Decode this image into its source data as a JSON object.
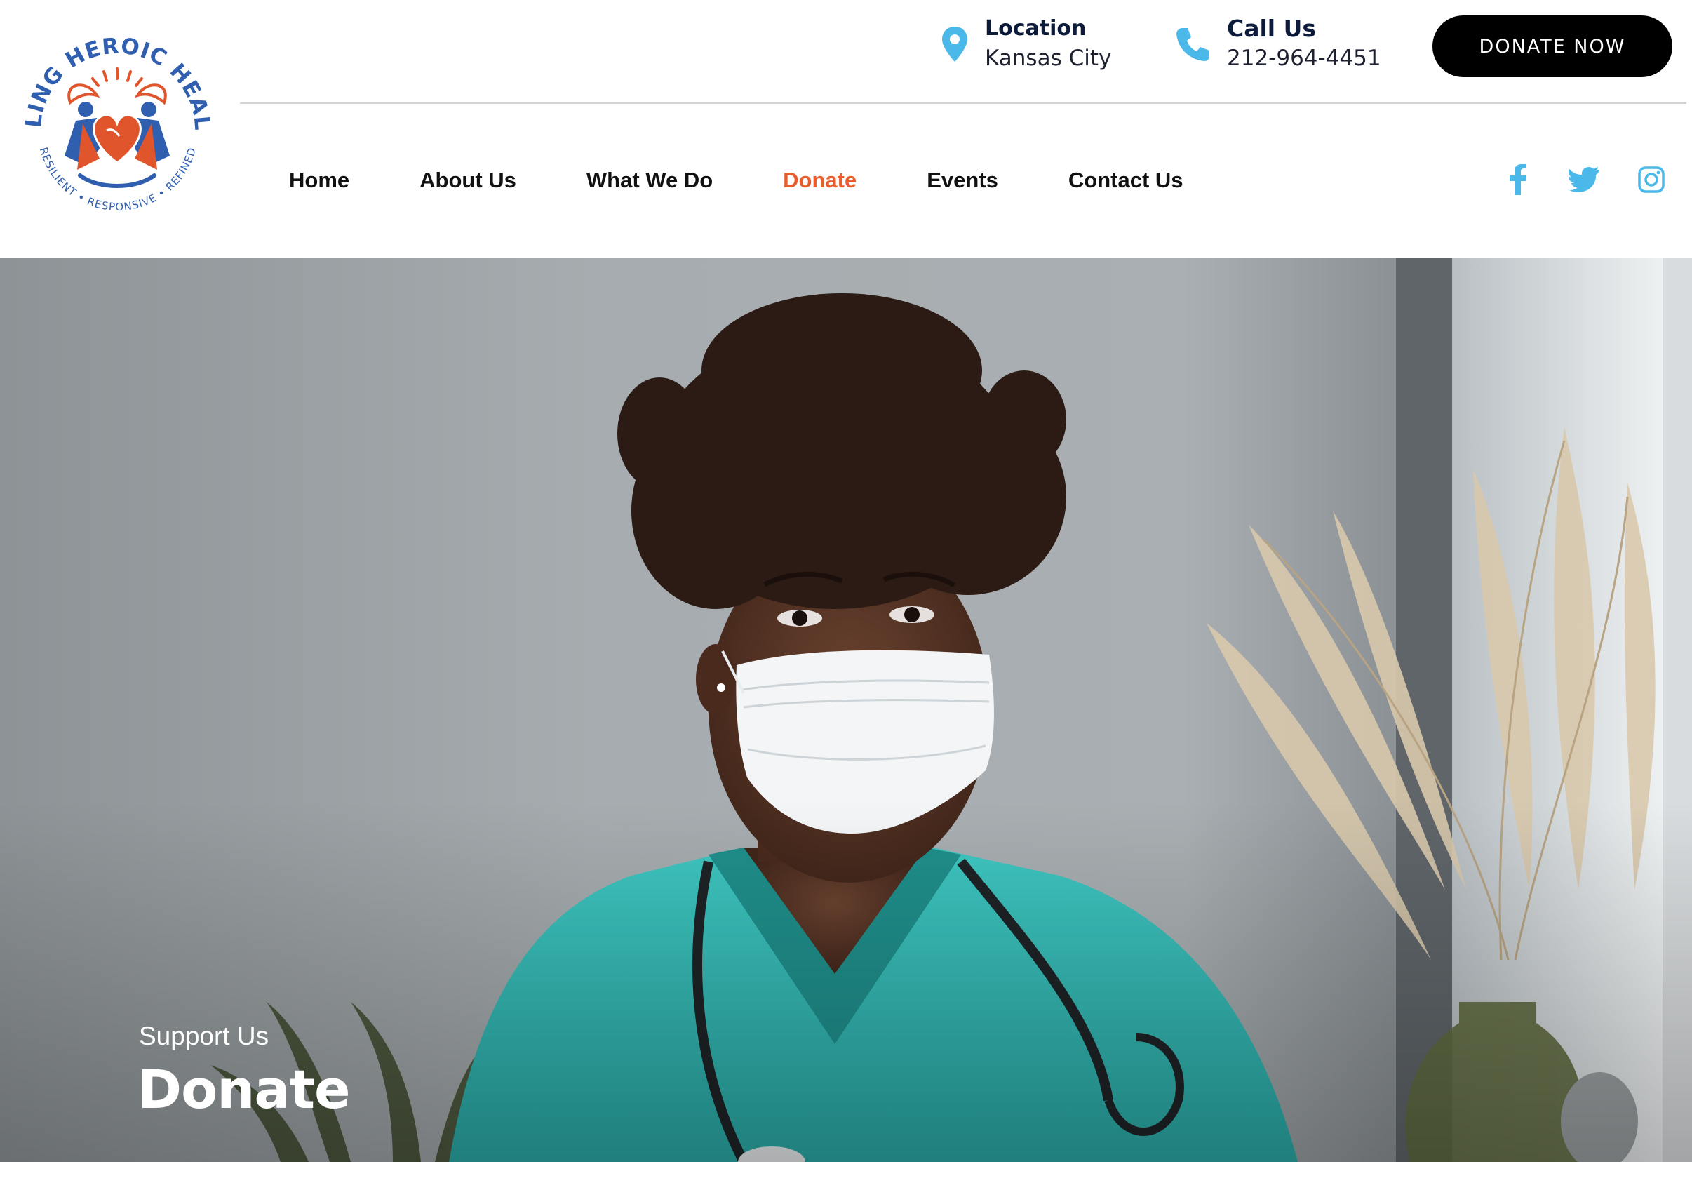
{
  "logo": {
    "top_text": "HEALING HEROIC HEALERS",
    "bottom_text": "RESILIENT • RESPONSIVE • REFINED",
    "colors": {
      "blue": "#2f5fae",
      "orange": "#e0552b"
    }
  },
  "header_info": {
    "location": {
      "title": "Location",
      "value": "Kansas City",
      "icon": "map-pin-icon"
    },
    "call": {
      "title": "Call Us",
      "value": "212-964-4451",
      "icon": "phone-icon"
    }
  },
  "donate_button": {
    "label": "DONATE NOW"
  },
  "nav": {
    "items": [
      {
        "label": "Home",
        "active": false
      },
      {
        "label": "About Us",
        "active": false
      },
      {
        "label": "What We Do",
        "active": false
      },
      {
        "label": "Donate",
        "active": true
      },
      {
        "label": "Events",
        "active": false
      },
      {
        "label": "Contact Us",
        "active": false
      }
    ],
    "active_color": "#e85d2e"
  },
  "social": [
    {
      "icon": "facebook-icon"
    },
    {
      "icon": "twitter-icon"
    },
    {
      "icon": "instagram-icon"
    }
  ],
  "social_color": "#4ab8e8",
  "hero": {
    "subtitle": "Support Us",
    "title": "Donate",
    "image": "nurse-in-mask-photo"
  }
}
